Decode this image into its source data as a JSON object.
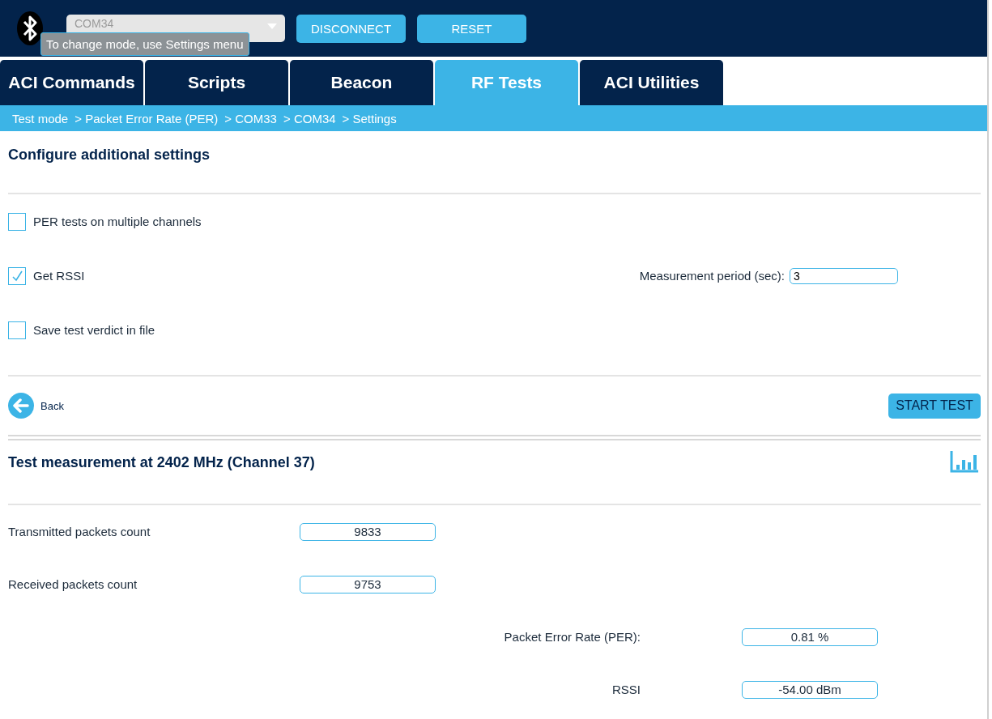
{
  "header": {
    "port_select": {
      "value": "COM34",
      "disabled": true
    },
    "tooltip": "To change mode, use Settings menu",
    "buttons": [
      "DISCONNECT",
      "RESET"
    ]
  },
  "tabs": [
    {
      "label": "ACI Commands",
      "selected": false
    },
    {
      "label": "Scripts",
      "selected": false
    },
    {
      "label": "Beacon",
      "selected": false
    },
    {
      "label": "RF Tests",
      "selected": true
    },
    {
      "label": "ACI Utilities",
      "selected": false
    }
  ],
  "breadcrumb": [
    "Test mode",
    "> Packet Error Rate (PER)",
    "> COM33",
    "> COM34",
    "> Settings"
  ],
  "settings": {
    "title": "Configure additional settings",
    "options": [
      {
        "label": "PER tests on multiple channels",
        "checked": false
      },
      {
        "label": "Get RSSI",
        "checked": true,
        "field": {
          "label": "Measurement period (sec):",
          "value": "3"
        }
      },
      {
        "label": "Save test verdict in file",
        "checked": false
      }
    ],
    "back": "Back",
    "start_button": "START TEST"
  },
  "measurement": {
    "title": "Test measurement at 2402 MHz (Channel 37)",
    "rows": [
      {
        "label": "Transmitted packets count",
        "value": "9833",
        "kind": "left"
      },
      {
        "label": "Received packets count",
        "value": "9753",
        "kind": "left"
      },
      {
        "label": "Packet Error Rate (PER):",
        "value": "0.81 %",
        "kind": "right"
      },
      {
        "label": "RSSI",
        "value": "-54.00 dBm",
        "kind": "right"
      }
    ]
  }
}
